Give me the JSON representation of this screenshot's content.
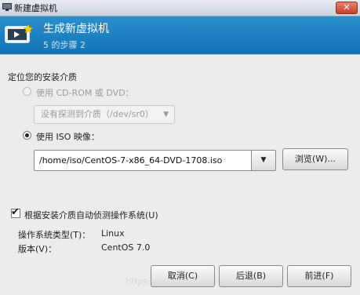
{
  "window": {
    "title": "新建虚拟机",
    "close_glyph": "✕"
  },
  "header": {
    "title": "生成新虚拟机",
    "step": "5 的步骤 2"
  },
  "section": {
    "title": "定位您的安装介质"
  },
  "cdrom": {
    "label": "使用 CD-ROM 或 DVD：",
    "combo_value": "没有探测到介质（/dev/sr0）",
    "enabled": false
  },
  "iso": {
    "label": "使用 ISO 映像：",
    "path": "/home/iso/CentOS-7-x86_64-DVD-1708.iso",
    "browse_label": "浏览(W)...",
    "selected": true
  },
  "autodetect": {
    "label": "根据安装介质自动侦测操作系统(U)",
    "checked": true,
    "os_type_label": "操作系统类型(T)：",
    "os_type_value": "Linux",
    "version_label": "版本(V)：",
    "version_value": "CentOS 7.0"
  },
  "buttons": {
    "cancel": "取消(C)",
    "back": "后退(B)",
    "forward": "前进(F)"
  },
  "watermark": "https://blog.csdn.net/qq_38892328",
  "colors": {
    "header_bg": "#1a7fc1",
    "close_button": "#d05a45"
  },
  "icons": {
    "app": "vm-app-icon",
    "wizard": "monitor-star-icon"
  }
}
